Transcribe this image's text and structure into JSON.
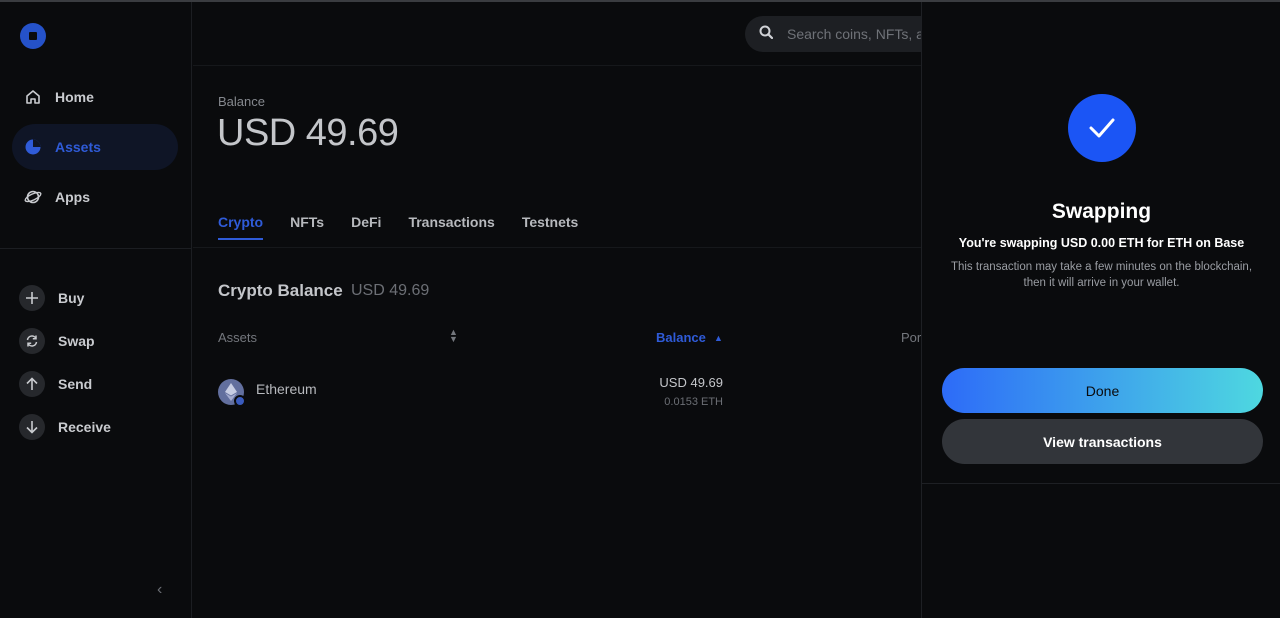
{
  "sidebar": {
    "nav": [
      {
        "label": "Home",
        "icon": "home-icon"
      },
      {
        "label": "Assets",
        "icon": "pie-chart-icon",
        "active": true
      },
      {
        "label": "Apps",
        "icon": "planet-icon"
      }
    ],
    "actions": [
      {
        "label": "Buy",
        "icon": "plus-icon"
      },
      {
        "label": "Swap",
        "icon": "swap-icon"
      },
      {
        "label": "Send",
        "icon": "arrow-up-icon"
      },
      {
        "label": "Receive",
        "icon": "arrow-down-icon"
      }
    ],
    "collapse_glyph": "‹"
  },
  "header": {
    "search_placeholder": "Search coins, NFTs, ap"
  },
  "main": {
    "balance_label": "Balance",
    "balance_value": "USD 49.69",
    "tabs": [
      "Crypto",
      "NFTs",
      "DeFi",
      "Transactions",
      "Testnets"
    ],
    "active_tab": "Crypto",
    "crypto_balance_title": "Crypto Balance",
    "crypto_balance_value": "USD 49.69",
    "columns": {
      "assets": "Assets",
      "balance": "Balance",
      "portfolio": "Por"
    },
    "assets": [
      {
        "name": "Ethereum",
        "usd": "USD 49.69",
        "amount": "0.0153 ETH",
        "icon": "ethereum-icon"
      }
    ]
  },
  "panel": {
    "title": "Swapping",
    "subtitle": "You're swapping USD 0.00 ETH for ETH on Base",
    "description": "This transaction may take a few minutes on the blockchain, then it will arrive in your wallet.",
    "done_label": "Done",
    "view_label": "View transactions"
  },
  "colors": {
    "accent": "#2f5bd8",
    "check_blue": "#1b55f5",
    "background": "#0a0b0d"
  }
}
